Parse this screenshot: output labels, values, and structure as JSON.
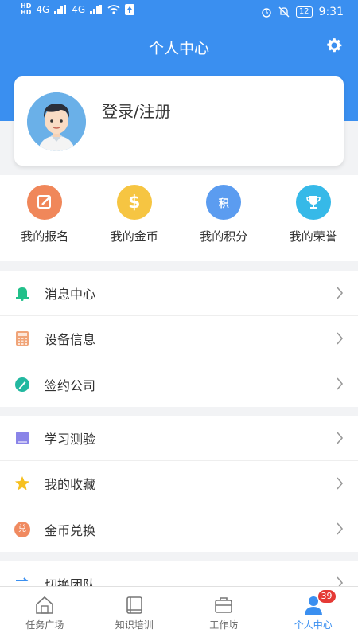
{
  "status_bar": {
    "hd1": "HD",
    "hd2": "HD",
    "network1": "4G",
    "network2": "4G",
    "battery": "12",
    "time": "9:31"
  },
  "header": {
    "title": "个人中心"
  },
  "profile": {
    "login_label": "登录/注册"
  },
  "quick_actions": [
    {
      "label": "我的报名",
      "icon": "edit-icon",
      "color": "#f0875a"
    },
    {
      "label": "我的金币",
      "icon": "dollar-coin-icon",
      "color": "#f6c542"
    },
    {
      "label": "我的积分",
      "icon": "points-bag-icon",
      "glyph": "积",
      "color": "#5b9cf0"
    },
    {
      "label": "我的荣誉",
      "icon": "trophy-icon",
      "color": "#36b9e8"
    }
  ],
  "menu_groups": [
    [
      {
        "label": "消息中心",
        "icon": "bell-icon",
        "color": "#22c08a"
      },
      {
        "label": "设备信息",
        "icon": "calculator-icon",
        "color": "#f0a478"
      },
      {
        "label": "签约公司",
        "icon": "pen-circle-icon",
        "color": "#22b8a0"
      }
    ],
    [
      {
        "label": "学习测验",
        "icon": "book-icon",
        "color": "#8a84e8"
      },
      {
        "label": "我的收藏",
        "icon": "star-icon",
        "color": "#f6c020"
      },
      {
        "label": "金币兑换",
        "icon": "exchange-coin-icon",
        "glyph": "兑",
        "color": "#f08a60"
      }
    ],
    [
      {
        "label": "切换团队",
        "icon": "switch-arrows-icon",
        "color": "#3a8ff0"
      }
    ]
  ],
  "tabs": [
    {
      "label": "任务广场",
      "icon": "home-icon"
    },
    {
      "label": "知识培训",
      "icon": "book-outline-icon"
    },
    {
      "label": "工作坊",
      "icon": "briefcase-icon"
    },
    {
      "label": "个人中心",
      "icon": "person-icon",
      "active": true,
      "badge": "39"
    }
  ],
  "colors": {
    "primary": "#3a8ff0",
    "badge": "#e53935"
  }
}
